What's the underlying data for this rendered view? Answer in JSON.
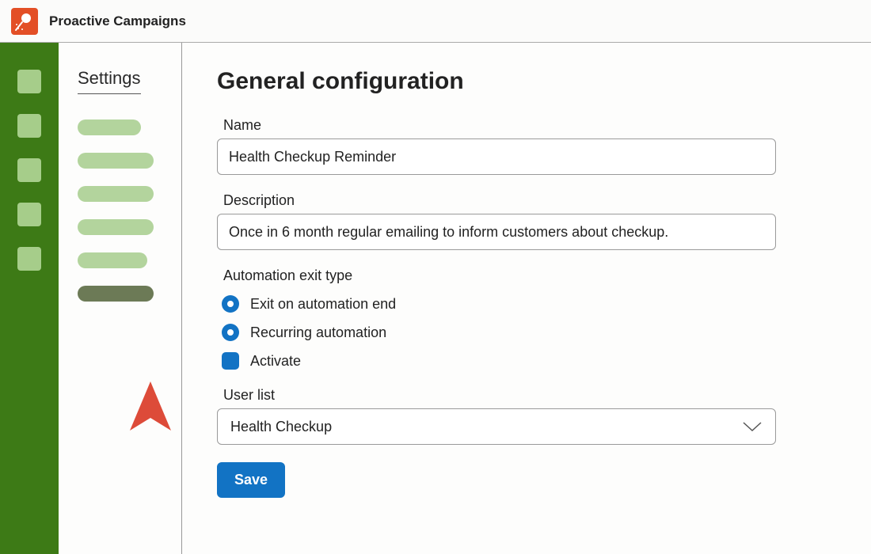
{
  "header": {
    "title": "Proactive Campaigns"
  },
  "subnav": {
    "title": "Settings"
  },
  "page": {
    "title": "General configuration",
    "name_label": "Name",
    "name_value": "Health Checkup Reminder",
    "description_label": "Description",
    "description_value": "Once in 6 month regular emailing to inform customers about checkup.",
    "automation_section": "Automation exit type",
    "options": {
      "exit_end": "Exit on automation end",
      "recurring": "Recurring automation",
      "activate": "Activate"
    },
    "userlist_label": "User list",
    "userlist_value": "Health Checkup",
    "save": "Save"
  }
}
